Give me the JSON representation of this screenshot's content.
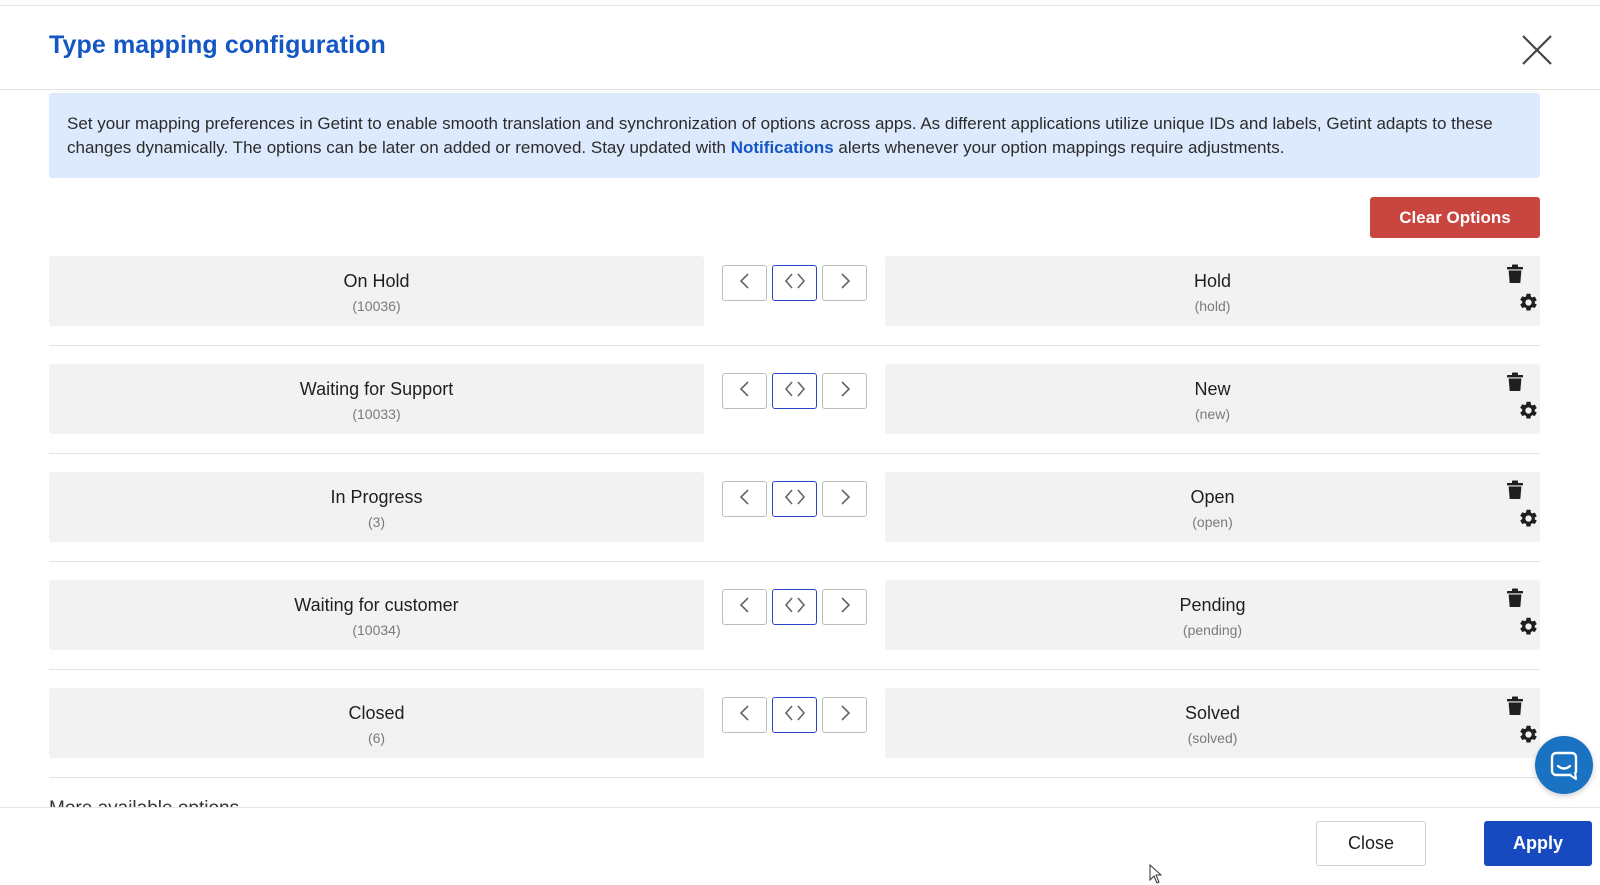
{
  "dialog": {
    "title": "Type mapping configuration"
  },
  "info": {
    "text_before": "Set your mapping preferences in Getint to enable smooth translation and synchronization of options across apps. As different applications utilize unique IDs and labels, Getint adapts to these changes dynamically. The options can be later on added or removed. Stay updated with ",
    "link": "Notifications",
    "text_after": " alerts whenever your option mappings require adjustments."
  },
  "actions": {
    "clear_options": "Clear Options"
  },
  "mappings": [
    {
      "left_label": "On Hold",
      "left_id": "(10036)",
      "right_label": "Hold",
      "right_id": "(hold)"
    },
    {
      "left_label": "Waiting for Support",
      "left_id": "(10033)",
      "right_label": "New",
      "right_id": "(new)"
    },
    {
      "left_label": "In Progress",
      "left_id": "(3)",
      "right_label": "Open",
      "right_id": "(open)"
    },
    {
      "left_label": "Waiting for customer",
      "left_id": "(10034)",
      "right_label": "Pending",
      "right_id": "(pending)"
    },
    {
      "left_label": "Closed",
      "left_id": "(6)",
      "right_label": "Solved",
      "right_id": "(solved)"
    }
  ],
  "footer": {
    "close": "Close",
    "apply": "Apply"
  },
  "colors": {
    "title": "#1457c4",
    "info_bg": "#dde9fd",
    "clear_button": "#c94540",
    "apply_button": "#1749c0",
    "bidirectional_border": "#2b45c8",
    "chat_bubble": "#1a72c2"
  },
  "icons": {
    "close": "close-x-icon",
    "left_arrow": "chevron-left-icon",
    "bidirectional": "chevron-both-icon",
    "right_arrow": "chevron-right-icon",
    "delete": "trash-icon",
    "settings": "gear-icon",
    "chat": "chat-bubble-icon"
  }
}
